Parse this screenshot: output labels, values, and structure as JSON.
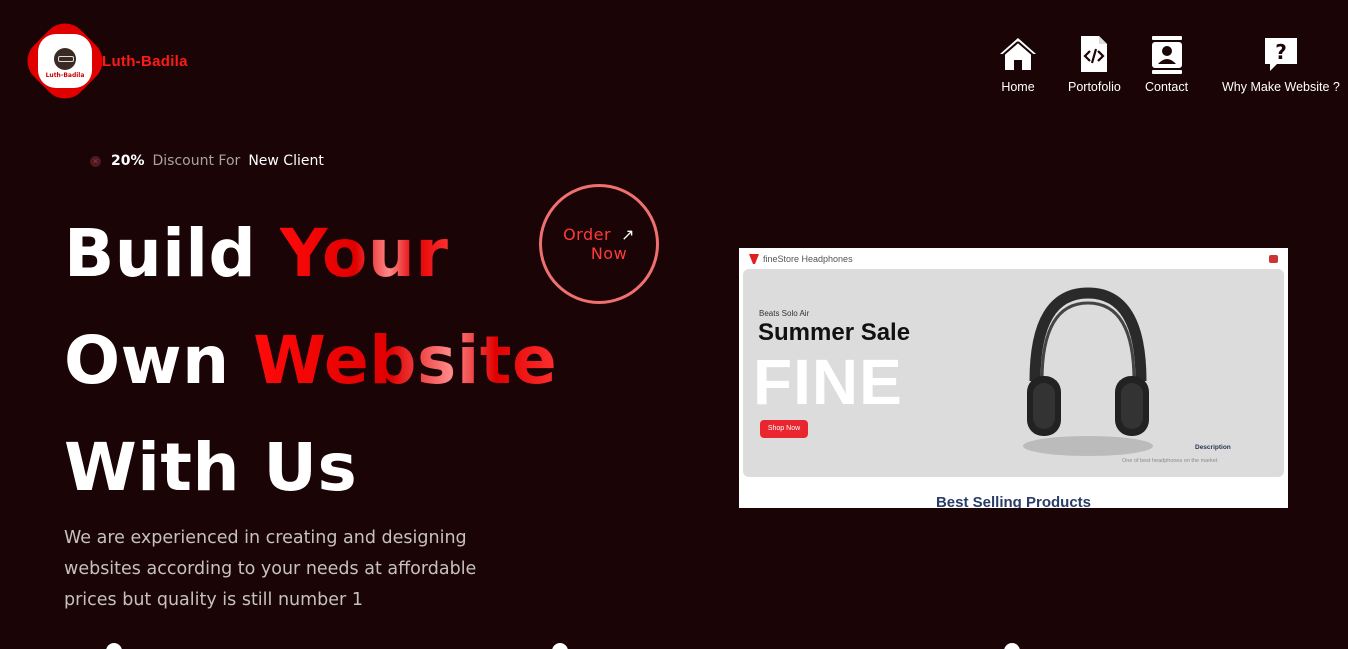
{
  "brand": {
    "name": "Luth-Badila",
    "badge_text": "Luth-Badila"
  },
  "nav": [
    {
      "label": "Home",
      "icon": "home-icon"
    },
    {
      "label": "Portofolio",
      "icon": "code-file-icon"
    },
    {
      "label": "Contact",
      "icon": "contact-card-icon"
    },
    {
      "label": "Why Make Website ?",
      "icon": "question-bubble-icon"
    }
  ],
  "discount": {
    "percent": "20%",
    "middle": "Discount For",
    "target": "New Client"
  },
  "headline": {
    "line1_white": "Build",
    "line1_red": "Your",
    "line2_white": "Own",
    "line2_red": "Website",
    "line3_white": "With Us"
  },
  "order": {
    "top": "Order",
    "bottom": "Now",
    "arrow": "↗"
  },
  "description": "We are experienced in creating and designing websites according to your needs at affordable prices but quality is still number 1",
  "preview": {
    "store_name": "fineStore Headphones",
    "subtitle": "Beats Solo Air",
    "title": "Summer Sale",
    "big_word": "FINE",
    "button": "Shop Now",
    "desc_heading": "Description",
    "desc_text": "One of best headphones on the market",
    "section_title": "Best Selling Products"
  },
  "colors": {
    "background": "#1a0406",
    "accent": "#e00000"
  }
}
